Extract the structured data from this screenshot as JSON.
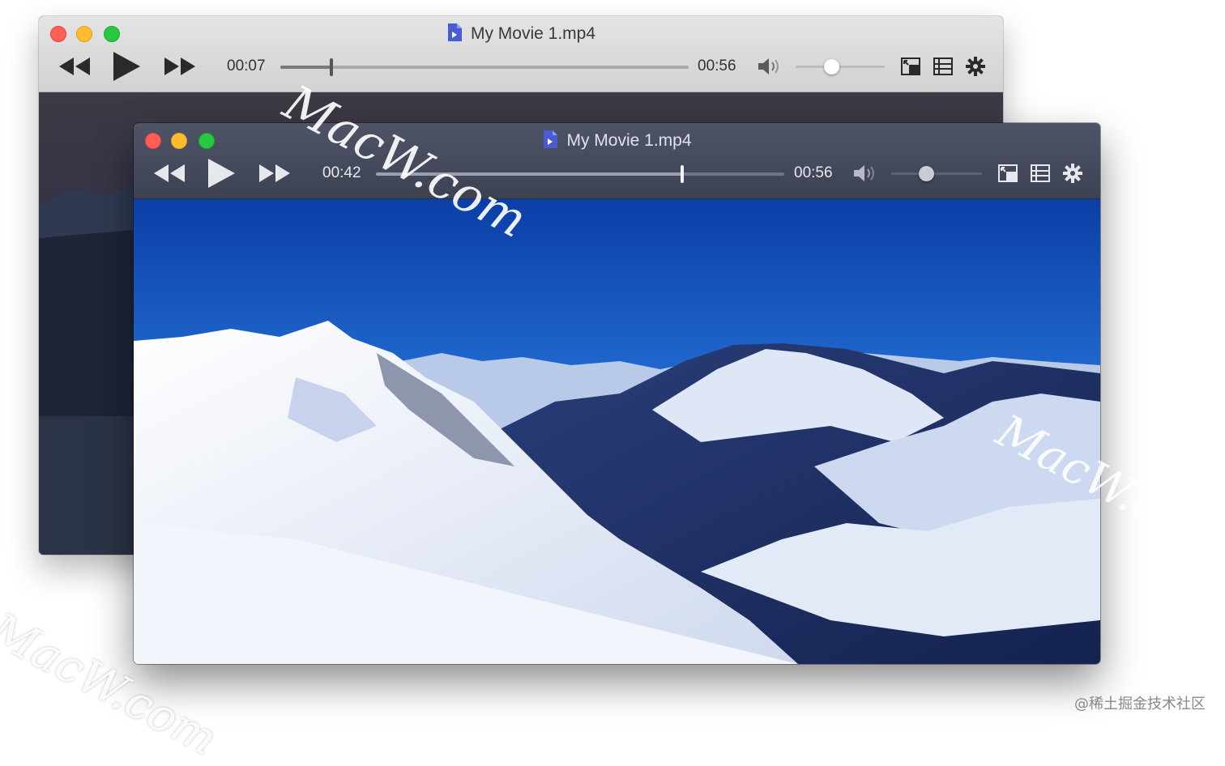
{
  "back_window": {
    "title": "My Movie 1.mp4",
    "current_time": "00:07",
    "duration": "00:56",
    "progress": 0.125,
    "volume": 0.4
  },
  "front_window": {
    "title": "My Movie 1.mp4",
    "current_time": "00:42",
    "duration": "00:56",
    "progress": 0.75,
    "volume": 0.38
  },
  "controls": {
    "rewind_icon": "rewind-icon",
    "play_icon": "play-icon",
    "fast_forward_icon": "fast-forward-icon",
    "volume_icon": "speaker-icon",
    "pip_icon": "picture-in-picture-icon",
    "playlist_icon": "playlist-icon",
    "settings_icon": "gear-icon"
  },
  "watermarks": [
    "MacW.com",
    "MacW.com",
    "MacW.com"
  ],
  "credit": "@稀土掘金技术社区",
  "colors": {
    "close": "#ff5f57",
    "minimize": "#febc2e",
    "maximize": "#28c840",
    "doc_icon": "#4a5bd6"
  }
}
